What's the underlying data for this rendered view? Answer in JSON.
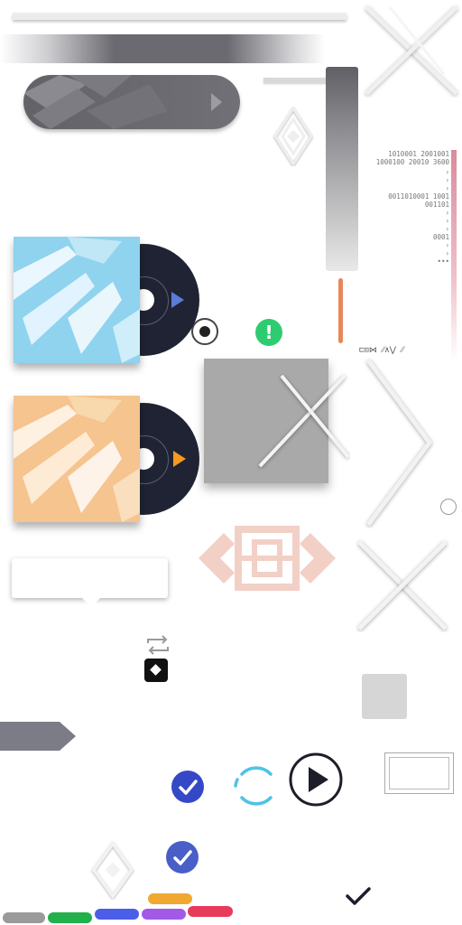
{
  "binary": {
    "lines": [
      "1010001 2001001",
      "1000100  20010  3600",
      "0011010001 1001",
      "001101",
      "0001"
    ],
    "dots": "•••",
    "code": "⊏⊡⋈ ⁄⁄∧⋁ ⁄⁄"
  },
  "albums": [
    {
      "cover_color": "#8fd3ee",
      "accent": "#5b7bd8",
      "play_icon": "play-triangle-icon"
    },
    {
      "cover_color": "#f5c48f",
      "accent": "#f59a1e",
      "play_icon": "play-triangle-icon"
    }
  ],
  "alert": {
    "symbol": "!"
  },
  "colors": {
    "checkbox": "#3548c8",
    "spinner": "#4fc3e8",
    "pills": [
      "#9a9a9a",
      "#21b04a",
      "#4a5ee8",
      "#a259e6",
      "#f0a830",
      "#e83a5a"
    ]
  }
}
